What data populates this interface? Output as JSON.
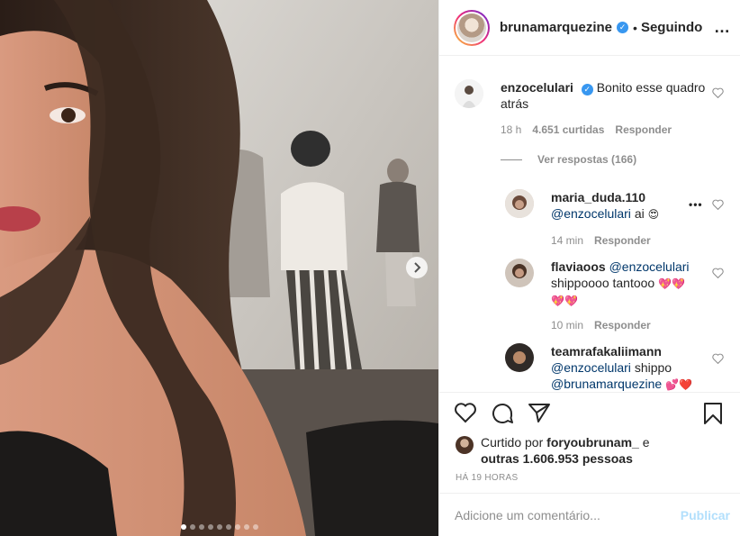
{
  "post": {
    "author": "brunamarquezine",
    "follow_separator": "•",
    "follow_state": "Seguindo",
    "more_icon": "…"
  },
  "comments": [
    {
      "user": "enzocelulari",
      "verified": true,
      "text": "Bonito esse quadro atrás",
      "time": "18 h",
      "likes": "4.651 curtidas",
      "reply": "Responder"
    }
  ],
  "view_replies": "Ver respostas (166)",
  "replies": [
    {
      "user": "maria_duda.110",
      "mention": "@enzocelulari",
      "text": "ai",
      "emoji": "😍",
      "time": "14 min",
      "reply": "Responder"
    },
    {
      "user": "flaviaoos",
      "mention": "@enzocelulari",
      "text": "shippoooo tantooo",
      "emoji": "💖💖",
      "emoji2": "💖💖",
      "time": "10 min",
      "reply": "Responder"
    },
    {
      "user": "teamrafakaliimann",
      "mention": "@enzocelulari",
      "text": "shippo",
      "mention2": "@brunamarquezine",
      "emoji": "💕❤️"
    }
  ],
  "liked_by": {
    "prefix": "Curtido por",
    "user": "foryoubrunam_",
    "conj": "e",
    "others": "outras 1.606.953 pessoas"
  },
  "posted_ago": "HÁ 19 HORAS",
  "comment_box": {
    "placeholder": "Adicione um comentário...",
    "submit": "Publicar"
  },
  "colors": {
    "link": "#00376b",
    "verified": "#3897f0",
    "secondary_text": "#8e8e8e",
    "publish_disabled": "#b2dffc"
  },
  "carousel": {
    "total": 9,
    "current": 1
  }
}
